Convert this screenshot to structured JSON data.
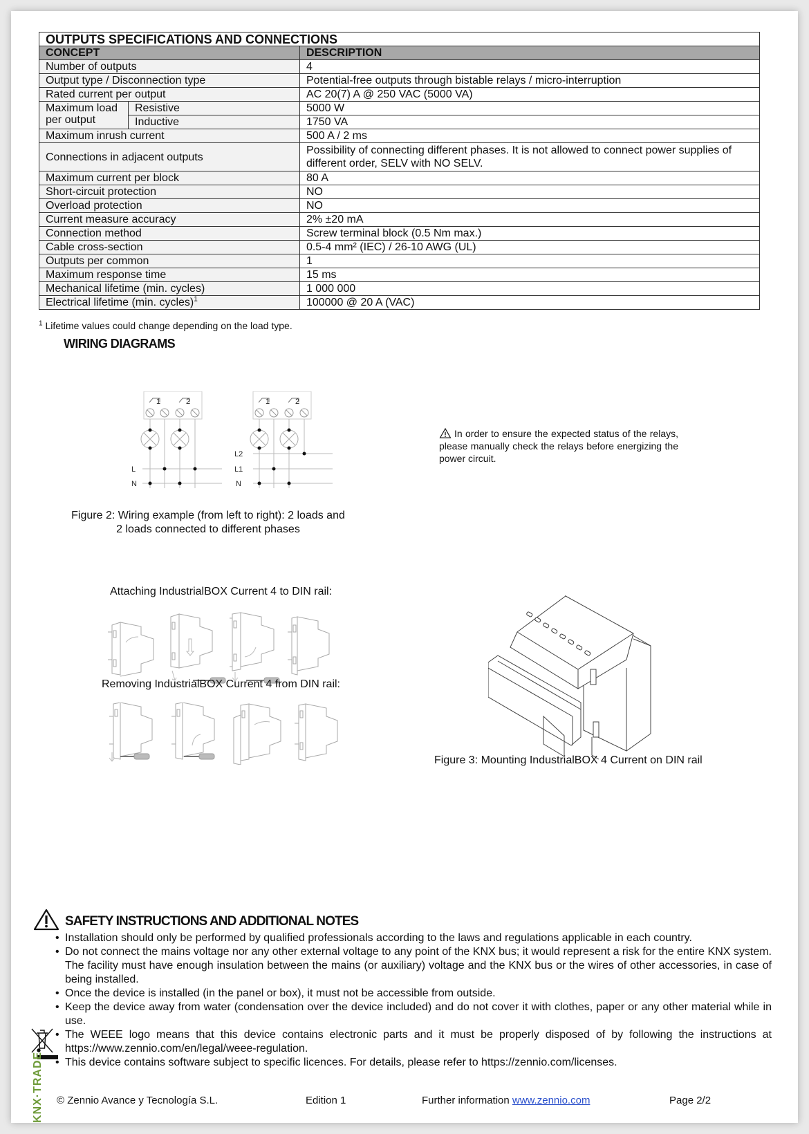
{
  "spec_table": {
    "title": "OUTPUTS SPECIFICATIONS AND CONNECTIONS",
    "headers": {
      "concept": "CONCEPT",
      "description": "DESCRIPTION"
    },
    "rows": [
      {
        "concept": "Number of outputs",
        "description": "4"
      },
      {
        "concept": "Output type / Disconnection type",
        "description": "Potential-free outputs through bistable relays / micro-interruption"
      },
      {
        "concept": "Rated current per output",
        "description": "AC 20(7) A @ 250 VAC (5000 VA)"
      },
      {
        "concept": "Maximum load per output",
        "sub": [
          {
            "label": "Resistive",
            "description": "5000 W"
          },
          {
            "label": "Inductive",
            "description": "1750 VA"
          }
        ],
        "concept_line1": "Maximum load",
        "concept_line2": "per output"
      },
      {
        "concept": "Maximum inrush current",
        "description": "500 A / 2 ms"
      },
      {
        "concept": "Connections in adjacent outputs",
        "description": "Possibility of connecting different phases. It is not allowed to connect power supplies of different order, SELV with NO SELV."
      },
      {
        "concept": "Maximum current per block",
        "description": "80 A"
      },
      {
        "concept": "Short-circuit protection",
        "description": "NO"
      },
      {
        "concept": "Overload protection",
        "description": "NO"
      },
      {
        "concept": "Current measure accuracy",
        "description": "2% ±20 mA"
      },
      {
        "concept": "Connection method",
        "description": "Screw terminal block (0.5 Nm max.)"
      },
      {
        "concept": "Cable cross-section",
        "description": "0.5-4 mm² (IEC) / 26-10 AWG (UL)"
      },
      {
        "concept": "Outputs per common",
        "description": "1"
      },
      {
        "concept": "Maximum response time",
        "description": "15 ms"
      },
      {
        "concept": "Mechanical lifetime (min. cycles)",
        "description": "1 000 000"
      },
      {
        "concept": "Electrical lifetime (min. cycles)",
        "concept_sup": "1",
        "description": "100000 @ 20 A (VAC)"
      }
    ],
    "footnote_mark": "1",
    "footnote": " Lifetime values could change depending on the load type."
  },
  "wiring": {
    "heading": "WIRING DIAGRAMS",
    "diagram_left": {
      "terminals": [
        "1",
        "2"
      ],
      "lines": [
        "L",
        "N"
      ]
    },
    "diagram_right": {
      "terminals": [
        "1",
        "2"
      ],
      "lines": [
        "L2",
        "L1",
        "N"
      ]
    },
    "relay_note": "In order to ensure the expected status of the relays, please manually check the relays before energizing the power circuit.",
    "relay_note_icon": "warning-triangle-icon",
    "figure2_caption_line1": "Figure 2: Wiring example (from left to right): 2 loads and",
    "figure2_caption_line2": "2 loads connected to different phases"
  },
  "din_rail": {
    "attach_label": "Attaching IndustrialBOX Current 4 to DIN rail:",
    "remove_label": "Removing IndustrialBOX Current 4 from DIN rail:",
    "figure3_caption": "Figure 3: Mounting IndustrialBOX 4 Current on DIN rail"
  },
  "safety": {
    "heading": "SAFETY INSTRUCTIONS AND ADDITIONAL NOTES",
    "items": [
      "Installation should only be performed by qualified professionals according to the laws and regulations applicable in each country.",
      "Do not connect the mains voltage nor any other external voltage to any point of the KNX bus; it would represent a risk for the entire KNX system. The facility must have enough insulation between the mains (or auxiliary) voltage and the KNX bus or the wires of other accessories, in case of being installed.",
      "Once the device is installed (in the panel or box), it must not be accessible from outside.",
      "Keep the device away from water (condensation over the device included) and do not cover it with clothes, paper or any other material while in use.",
      "The WEEE logo means that this device contains electronic parts and it must be properly disposed of by following the instructions at https://www.zennio.com/en/legal/weee-regulation.",
      "This device contains software subject to specific licences. For details, please refer to https://zennio.com/licenses."
    ]
  },
  "brand_watermark": "KNX·TRADE",
  "colors": {
    "header_gray": "#a8a8a8",
    "brand_green": "#6e9b3a",
    "link_blue": "#2a4fcc"
  },
  "footer": {
    "copyright": "© Zennio Avance y Tecnología S.L.",
    "edition": "Edition 1",
    "further_info": "Further information ",
    "link": "www.zennio.com",
    "page": "Page 2/2"
  }
}
